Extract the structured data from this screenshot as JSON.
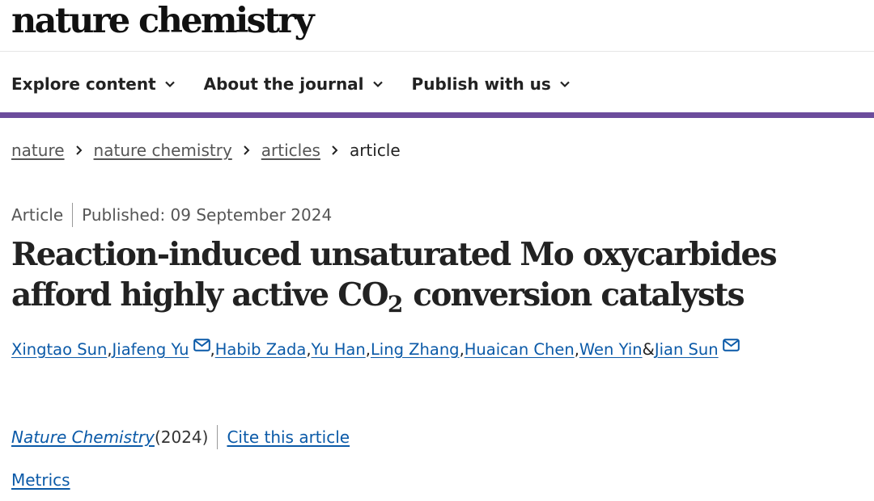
{
  "site": {
    "logo_text": "nature chemistry"
  },
  "nav": {
    "items": [
      {
        "label": "Explore content",
        "icon": "chevron-down-icon"
      },
      {
        "label": "About the journal",
        "icon": "chevron-down-icon"
      },
      {
        "label": "Publish with us",
        "icon": "chevron-down-icon"
      }
    ]
  },
  "breadcrumb": {
    "items": [
      {
        "label": "nature"
      },
      {
        "label": "nature chemistry"
      },
      {
        "label": "articles"
      }
    ],
    "current": "article"
  },
  "article": {
    "type": "Article",
    "published": "Published: 09 September 2024",
    "title_part1": "Reaction-induced unsaturated Mo oxycarbides afford highly active CO",
    "title_sub": "2",
    "title_part2": " conversion catalysts",
    "authors": [
      {
        "name": "Xingtao Sun",
        "corresponding": false,
        "sep": ", "
      },
      {
        "name": "Jiafeng Yu",
        "corresponding": true,
        "sep": ", "
      },
      {
        "name": "Habib Zada",
        "corresponding": false,
        "sep": ", "
      },
      {
        "name": "Yu Han",
        "corresponding": false,
        "sep": ", "
      },
      {
        "name": "Ling Zhang",
        "corresponding": false,
        "sep": ", "
      },
      {
        "name": "Huaican Chen",
        "corresponding": false,
        "sep": ", "
      },
      {
        "name": "Wen Yin",
        "corresponding": false,
        "sep": " & "
      },
      {
        "name": "Jian Sun",
        "corresponding": true,
        "sep": ""
      }
    ],
    "journal": "Nature Chemistry",
    "year": " (2024)",
    "cite_label": "Cite this article",
    "metrics_label": "Metrics"
  },
  "colors": {
    "accent_bar": "#6c4c9c",
    "link": "#0b5aa8",
    "text": "#222222",
    "muted": "#555555"
  }
}
